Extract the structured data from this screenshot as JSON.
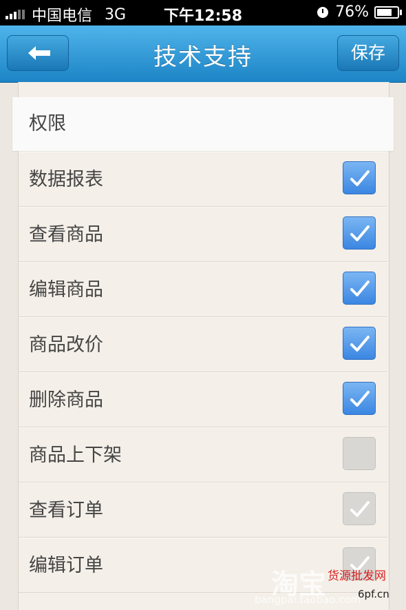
{
  "status_bar": {
    "carrier": "中国电信",
    "network": "3G",
    "time": "下午12:58",
    "battery": "76%",
    "battery_level": 0.76
  },
  "nav": {
    "title": "技术支持",
    "back_icon": "back-arrow-icon",
    "save_label": "保存"
  },
  "section": {
    "title": "权限"
  },
  "permissions": [
    {
      "label": "数据报表",
      "checked": true
    },
    {
      "label": "查看商品",
      "checked": true
    },
    {
      "label": "编辑商品",
      "checked": true
    },
    {
      "label": "商品改价",
      "checked": true
    },
    {
      "label": "删除商品",
      "checked": true
    },
    {
      "label": "商品上下架",
      "checked": false
    },
    {
      "label": "查看订单",
      "checked": "disabled"
    },
    {
      "label": "编辑订单",
      "checked": "disabled"
    }
  ],
  "watermark": {
    "brand": "淘宝",
    "site_name": "货源批发网",
    "site_short": "6pf.cn",
    "domain": "bangpai.taobao.com"
  },
  "colors": {
    "nav_blue": "#2a93d3",
    "checkbox_on": "#4a90e2",
    "checkbox_off": "#d9d7d4"
  }
}
